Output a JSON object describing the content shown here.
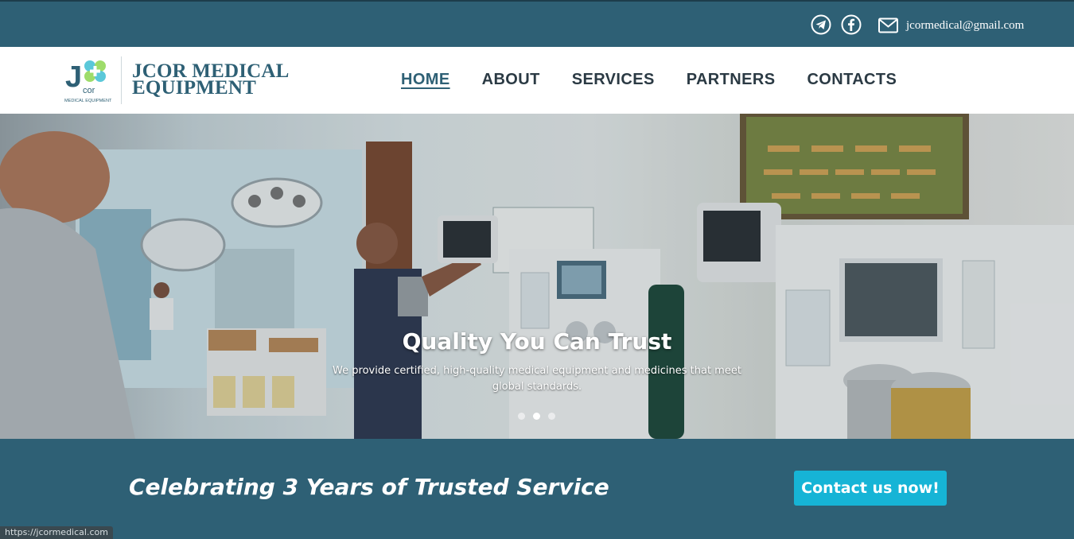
{
  "topbar": {
    "email": "jcormedical@gmail.com",
    "icons": [
      "telegram-icon",
      "facebook-icon",
      "mail-icon"
    ]
  },
  "brand": {
    "logo_letter": "J",
    "logo_sub": "cor",
    "logo_caption": "MEDICAL EQUIPMENT",
    "name_line1": "JCOR MEDICAL",
    "name_line2": "EQUIPMENT"
  },
  "nav": {
    "items": [
      "HOME",
      "ABOUT",
      "SERVICES",
      "PARTNERS",
      "CONTACTS"
    ],
    "active": "HOME"
  },
  "hero": {
    "title": "Quality You Can Trust",
    "subtitle": "We provide certified, high-quality medical equipment and medicines that meet global standards.",
    "slides": 3,
    "active_slide": 2
  },
  "banner": {
    "text": "Celebrating 3 Years of Trusted Service",
    "cta_label": "Contact us now!"
  },
  "status_bar": {
    "url": "https://jcormedical.com"
  },
  "colors": {
    "primary": "#2e6075",
    "accent": "#16b4d6",
    "header_bg": "#ffffff",
    "nav_text": "#2b3a44"
  }
}
